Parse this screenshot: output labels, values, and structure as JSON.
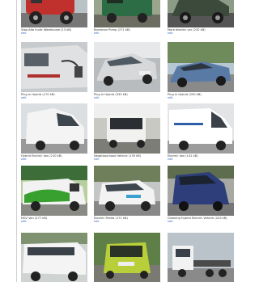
{
  "gallery": {
    "items": [
      {
        "caption": "Xiao-Alto Inuitr Warehouse (13 kB)",
        "edit": "edit",
        "icon": "red-utility-vehicle-photo"
      },
      {
        "caption": "Borisman Pump (271 kB)",
        "edit": "edit",
        "icon": "green-utility-vehicle-photo"
      },
      {
        "caption": "Mare electric car (232 kB)",
        "edit": "edit",
        "icon": "dark-green-car-photo"
      },
      {
        "caption": "Plug In Hybrid (170 kB)",
        "edit": "edit",
        "icon": "silver-van-charging-photo"
      },
      {
        "caption": "Plug In Hybrid (335 kB)",
        "edit": "edit",
        "icon": "silver-hatchback-photo"
      },
      {
        "caption": "Plug In Hybrid (290 kB)",
        "edit": "edit",
        "icon": "blue-hatchback-photo"
      },
      {
        "caption": "Hybrid Electric Van (210 kB)",
        "edit": "edit",
        "icon": "white-van-photo"
      },
      {
        "caption": "Neighbourhood Vehicle (139 kB)",
        "edit": "edit",
        "icon": "white-neighbourhood-vehicle-photo"
      },
      {
        "caption": "Electric Van (141 kB)",
        "edit": "edit",
        "icon": "white-electric-van-photo"
      },
      {
        "caption": "NGV Van (277 kB)",
        "edit": "edit",
        "icon": "green-ngv-van-photo"
      },
      {
        "caption": "Electric Panda (171 kB)",
        "edit": "edit",
        "icon": "white-panda-photo"
      },
      {
        "caption": "Cleaning Hybrid Electric Vehicle (243 kB)",
        "edit": "edit",
        "icon": "blue-van-photo"
      },
      {
        "caption": "",
        "edit": "",
        "icon": "white-shuttle-photo"
      },
      {
        "caption": "",
        "edit": "",
        "icon": "yellow-green-car-photo"
      },
      {
        "caption": "",
        "edit": "",
        "icon": "white-truck-photo"
      }
    ]
  }
}
